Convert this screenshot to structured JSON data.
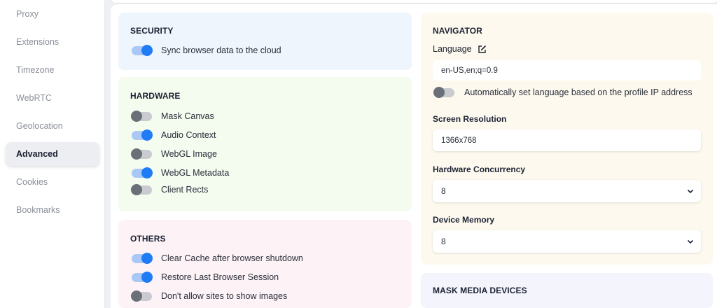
{
  "sidebar": {
    "items": [
      {
        "label": "Proxy"
      },
      {
        "label": "Extensions"
      },
      {
        "label": "Timezone"
      },
      {
        "label": "WebRTC"
      },
      {
        "label": "Geolocation"
      },
      {
        "label": "Advanced",
        "active": true
      },
      {
        "label": "Cookies"
      },
      {
        "label": "Bookmarks"
      }
    ]
  },
  "security": {
    "title": "SECURITY",
    "sync_label": "Sync browser data to the cloud",
    "sync_on": true
  },
  "hardware": {
    "title": "HARDWARE",
    "items": [
      {
        "label": "Mask Canvas",
        "on": false
      },
      {
        "label": "Audio Context",
        "on": true
      },
      {
        "label": "WebGL Image",
        "on": false
      },
      {
        "label": "WebGL Metadata",
        "on": true
      },
      {
        "label": "Client Rects",
        "on": false
      }
    ]
  },
  "others": {
    "title": "OTHERS",
    "items": [
      {
        "label": "Clear Cache after browser shutdown",
        "on": true
      },
      {
        "label": "Restore Last Browser Session",
        "on": true
      },
      {
        "label": "Don't allow sites to show images",
        "on": false
      }
    ]
  },
  "navigator": {
    "title": "NAVIGATOR",
    "language_label": "Language",
    "language_value": "en-US,en;q=0.9",
    "auto_lang_label": "Automatically set language based on the profile IP address",
    "auto_lang_on": false,
    "screen_res_label": "Screen Resolution",
    "screen_res_value": "1366x768",
    "hw_concurrency_label": "Hardware Concurrency",
    "hw_concurrency_value": "8",
    "device_memory_label": "Device Memory",
    "device_memory_value": "8"
  },
  "mask_media": {
    "title": "MASK MEDIA DEVICES"
  },
  "colors": {
    "accent": "#1f7cf5",
    "security_bg": "#eef5fd",
    "hardware_bg": "#f4fbef",
    "others_bg": "#fdf2f6",
    "navigator_bg": "#fdf9ef",
    "mask_bg": "#f3f4fc"
  }
}
